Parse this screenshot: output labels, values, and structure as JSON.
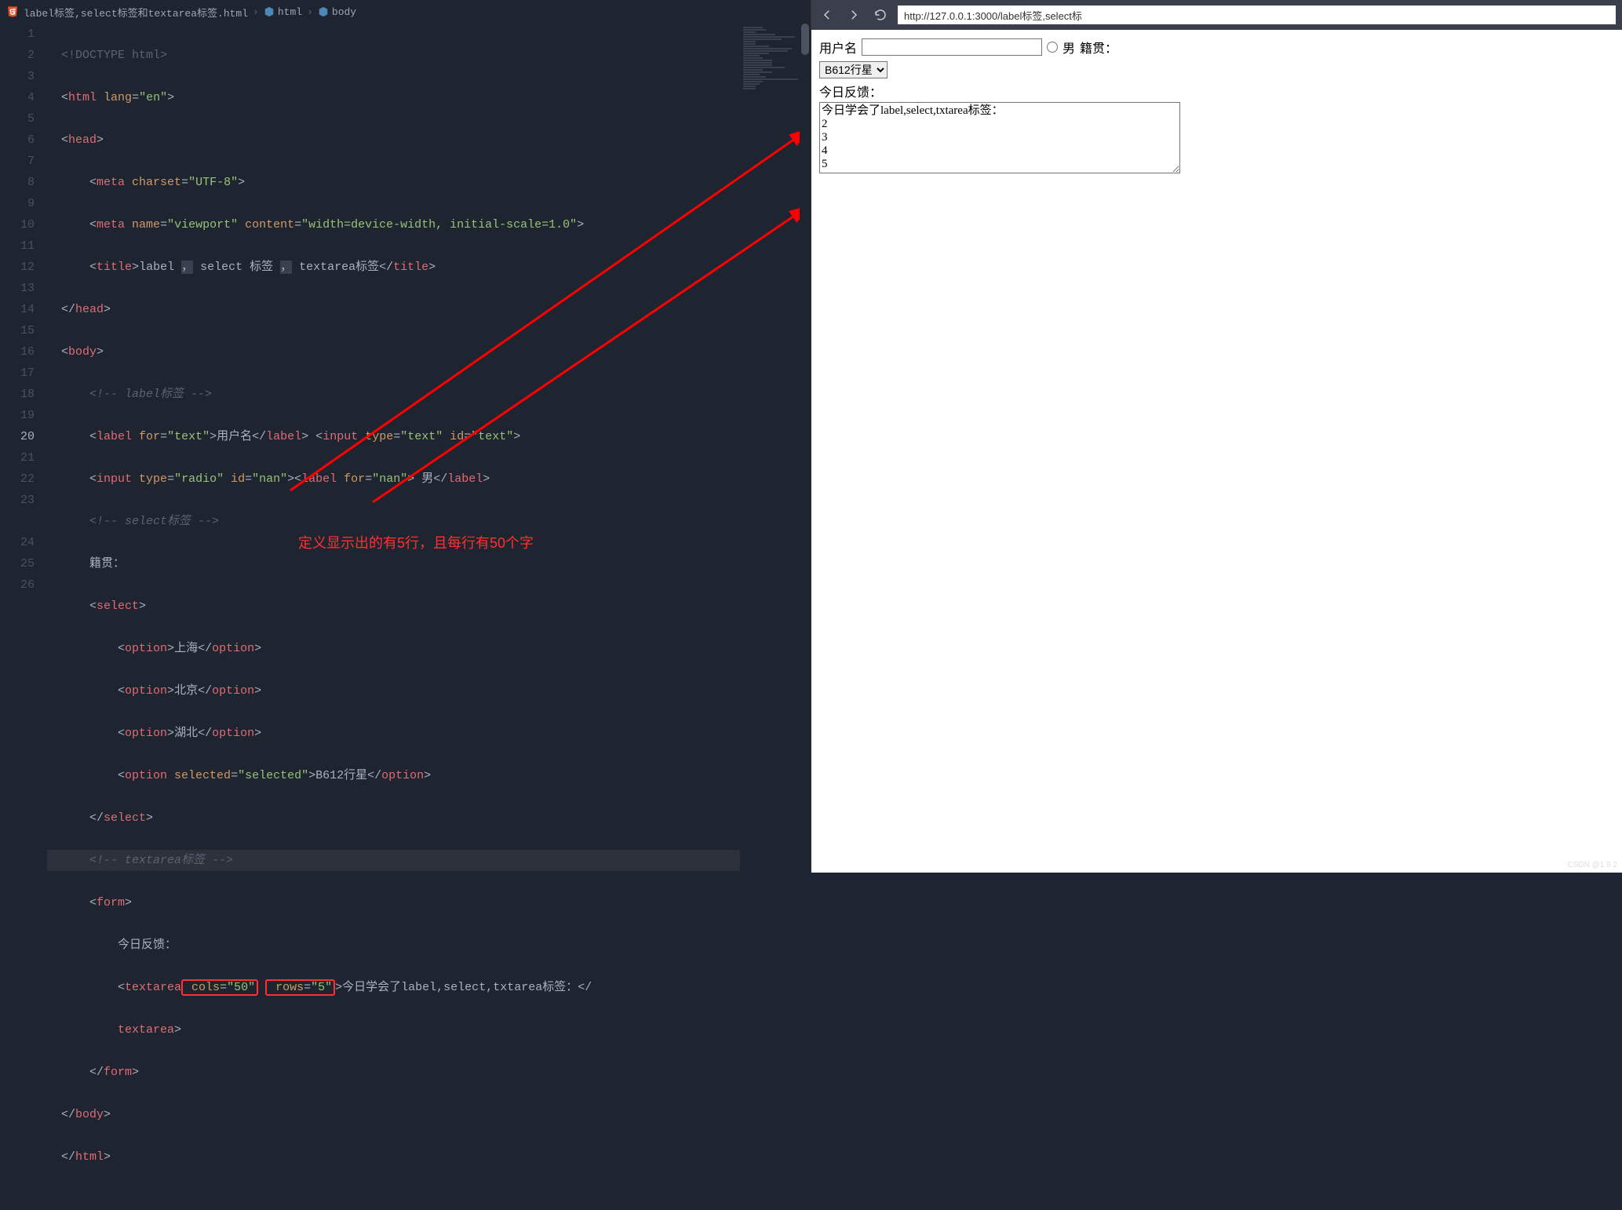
{
  "breadcrumb": {
    "file": "label标签,select标签和textarea标签.html",
    "path1": "html",
    "path2": "body"
  },
  "lines": [
    "1",
    "2",
    "3",
    "4",
    "5",
    "6",
    "7",
    "8",
    "9",
    "10",
    "11",
    "12",
    "13",
    "14",
    "15",
    "16",
    "17",
    "18",
    "19",
    "20",
    "21",
    "22",
    "23",
    "",
    "24",
    "25",
    "26"
  ],
  "active_line_index": 19,
  "code": {
    "l1_a": "<!",
    "l1_b": "DOCTYPE",
    "l1_c": " html",
    "l1_d": ">",
    "l2_a": "<",
    "l2_b": "html",
    "l2_c": " lang",
    "l2_d": "=",
    "l2_e": "\"en\"",
    "l2_f": ">",
    "l3_a": "<",
    "l3_b": "head",
    "l3_c": ">",
    "l4_a": "<",
    "l4_b": "meta",
    "l4_c": " charset",
    "l4_d": "=",
    "l4_e": "\"UTF-8\"",
    "l4_f": ">",
    "l5_a": "<",
    "l5_b": "meta",
    "l5_c": " name",
    "l5_d": "=",
    "l5_e": "\"viewport\"",
    "l5_f": " content",
    "l5_g": "=",
    "l5_h": "\"width=device-width, initial-scale=1.0\"",
    "l5_i": ">",
    "l6_a": "<",
    "l6_b": "title",
    "l6_c": ">",
    "l6_d": "label ",
    "l6_e": "，",
    "l6_f": " select 标签 ",
    "l6_g": "，",
    "l6_h": " textarea标签",
    "l6_i": "</",
    "l6_j": "title",
    "l6_k": ">",
    "l7_a": "</",
    "l7_b": "head",
    "l7_c": ">",
    "l8_a": "<",
    "l8_b": "body",
    "l8_c": ">",
    "l9": "<!-- label标签 -->",
    "l10_a": "<",
    "l10_b": "label",
    "l10_c": " for",
    "l10_d": "=",
    "l10_e": "\"text\"",
    "l10_f": ">",
    "l10_g": "用户名",
    "l10_h": "</",
    "l10_i": "label",
    "l10_j": ">",
    "l10_k": " <",
    "l10_l": "input",
    "l10_m": " type",
    "l10_n": "=",
    "l10_o": "\"text\"",
    "l10_p": " id",
    "l10_q": "=",
    "l10_r": "\"text\"",
    "l10_s": ">",
    "l11_a": "<",
    "l11_b": "input",
    "l11_c": " type",
    "l11_d": "=",
    "l11_e": "\"radio\"",
    "l11_f": " id",
    "l11_g": "=",
    "l11_h": "\"nan\"",
    "l11_i": "><",
    "l11_j": "label",
    "l11_k": " for",
    "l11_l": "=",
    "l11_m": "\"nan\"",
    "l11_n": ">",
    "l11_o": " 男",
    "l11_p": "</",
    "l11_q": "label",
    "l11_r": ">",
    "l12": "<!-- select标签 -->",
    "l13": "籍贯：",
    "l14_a": "<",
    "l14_b": "select",
    "l14_c": ">",
    "l15_a": "<",
    "l15_b": "option",
    "l15_c": ">",
    "l15_d": "上海",
    "l15_e": "</",
    "l15_f": "option",
    "l15_g": ">",
    "l16_a": "<",
    "l16_b": "option",
    "l16_c": ">",
    "l16_d": "北京",
    "l16_e": "</",
    "l16_f": "option",
    "l16_g": ">",
    "l17_a": "<",
    "l17_b": "option",
    "l17_c": ">",
    "l17_d": "湖北",
    "l17_e": "</",
    "l17_f": "option",
    "l17_g": ">",
    "l18_a": "<",
    "l18_b": "option",
    "l18_c": " selected",
    "l18_d": "=",
    "l18_e": "\"selected\"",
    "l18_f": ">",
    "l18_g": "B612行星",
    "l18_h": "</",
    "l18_i": "option",
    "l18_j": ">",
    "l19_a": "</",
    "l19_b": "select",
    "l19_c": ">",
    "l20": "<!-- textarea标签 -->",
    "l21_a": "<",
    "l21_b": "form",
    "l21_c": ">",
    "l22": "今日反馈：",
    "l23_a": "<",
    "l23_b": "textarea",
    "l23_c": " cols",
    "l23_d": "=",
    "l23_e": "\"50\"",
    "l23_f": " rows",
    "l23_g": "=",
    "l23_h": "\"5\"",
    "l23_i": ">",
    "l23_j": "今日学会了label,select,txtarea标签：",
    "l23_k": "</",
    "l23b_a": "textarea",
    "l23b_b": ">",
    "l24_a": "</",
    "l24_b": "form",
    "l24_c": ">",
    "l25_a": "</",
    "l25_b": "body",
    "l25_c": ">",
    "l26_a": "</",
    "l26_b": "html",
    "l26_c": ">"
  },
  "annotation": "定义显示出的有5行，且每行有50个字",
  "browser": {
    "url": "http://127.0.0.1:3000/label标签,select标",
    "label_username": "用户名",
    "label_male": "男",
    "label_origin": "籍贯：",
    "select_value": "B612行星",
    "feedback_label": "今日反馈：",
    "textarea_value": "今日学会了label,select,txtarea标签：\n2\n3\n4\n5"
  },
  "watermark": "CSDN @1 9 2"
}
